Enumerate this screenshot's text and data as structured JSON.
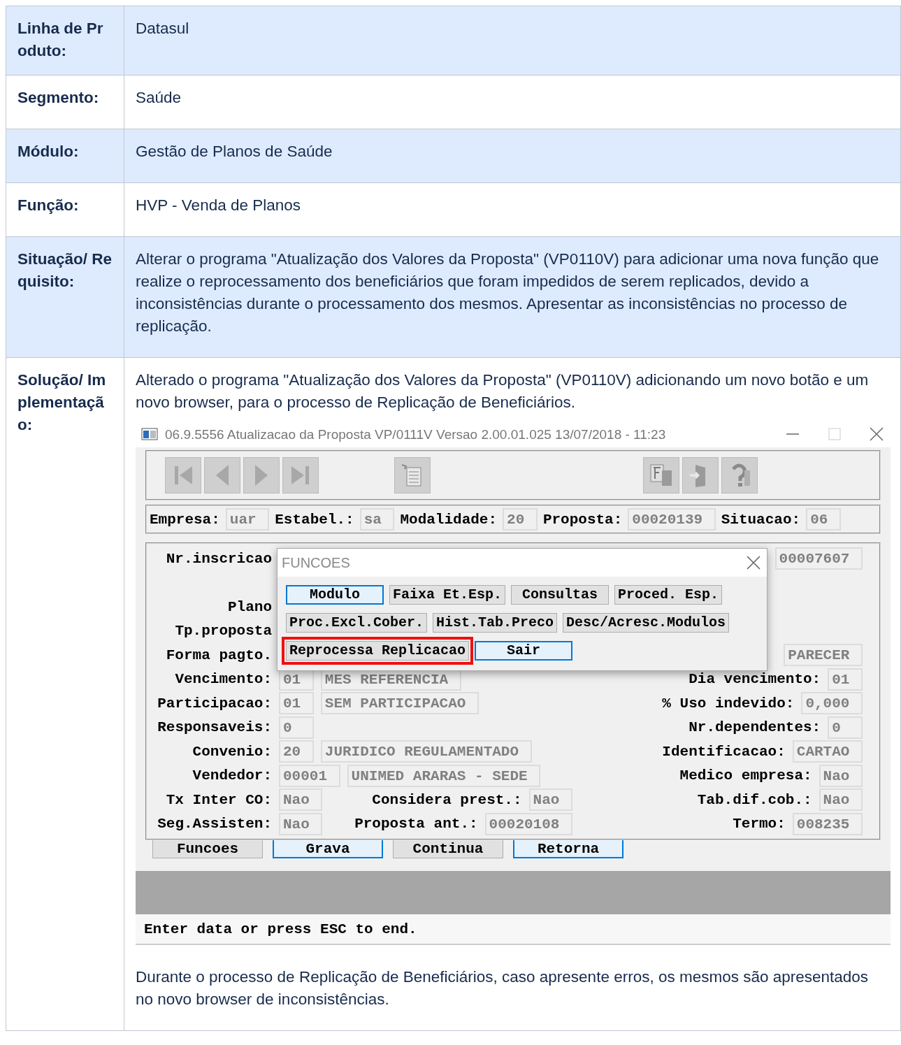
{
  "rows": [
    {
      "label": "Linha de Produto:",
      "highlighted": true,
      "content": [
        {
          "kind": "paragraph",
          "text": "Datasul"
        }
      ]
    },
    {
      "label": "Segmento:",
      "highlighted": false,
      "content": [
        {
          "kind": "paragraph",
          "text": "Saúde"
        }
      ]
    },
    {
      "label": "Módulo:",
      "highlighted": true,
      "content": [
        {
          "kind": "paragraph",
          "text": "Gestão de Planos de Saúde"
        }
      ]
    },
    {
      "label": "Função:",
      "highlighted": false,
      "content": [
        {
          "kind": "paragraph",
          "text": "HVP - Venda de Planos"
        }
      ]
    },
    {
      "label": "Situação/ Requisito:",
      "highlighted": true,
      "content": [
        {
          "kind": "paragraph",
          "text": "Alterar o programa \"Atualização dos Valores da Proposta\" (VP0110V) para adicionar uma nova função que realize o reprocessamento dos beneficiários que foram impedidos de serem replicados, devido a inconsistências durante o processamento dos mesmos. Apresentar as inconsistências no processo de replicação."
        }
      ]
    },
    {
      "label": "Solução/ Implementação:",
      "highlighted": false,
      "content": [
        {
          "kind": "paragraph",
          "text": "Alterado o programa \"Atualização dos Valores da Proposta\" (VP0110V) adicionando um novo botão e um novo browser, para o processo de Replicação de Beneficiários."
        },
        {
          "kind": "screenshot",
          "window": {
            "title": "06.9.5556 Atualizacao da Proposta VP/0111V Versao 2.00.01.025 13/07/2018 - 11:23",
            "header_fields": [
              {
                "label": "Empresa:",
                "value": "uar"
              },
              {
                "label": "Estabel.:",
                "value": "sa"
              },
              {
                "label": "Modalidade:",
                "value": "20"
              },
              {
                "label": "Proposta:",
                "value": "00020139"
              },
              {
                "label": "Situacao:",
                "value": "06"
              }
            ],
            "form_rows": [
              {
                "kind": "fields",
                "groups": [
                  {
                    "label": "Nr.inscricao"
                  },
                  {
                    "fields": [
                      "00007607"
                    ]
                  }
                ]
              },
              {
                "kind": "blank"
              },
              {
                "kind": "fields",
                "groups": [
                  {
                    "label": "Plano"
                  }
                ]
              },
              {
                "kind": "fields",
                "groups": [
                  {
                    "label": "Tp.proposta"
                  }
                ]
              },
              {
                "kind": "fields",
                "groups": [
                  {
                    "label": "Forma pagto."
                  },
                  {
                    "fields": [
                      "PARECER"
                    ]
                  }
                ]
              },
              {
                "kind": "fields",
                "groups": [
                  {
                    "label": "Vencimento:",
                    "fields": [
                      "01",
                      "MES REFERENCIA"
                    ]
                  },
                  {
                    "label": "Dia vencimento:",
                    "fields": [
                      "01"
                    ]
                  }
                ]
              },
              {
                "kind": "fields",
                "groups": [
                  {
                    "label": "Participacao:",
                    "fields": [
                      "01",
                      "SEM PARTICIPACAO"
                    ]
                  },
                  {
                    "label": "% Uso indevido:",
                    "fields": [
                      "0,000"
                    ]
                  }
                ]
              },
              {
                "kind": "fields",
                "groups": [
                  {
                    "label": "Responsaveis:",
                    "fields": [
                      "0"
                    ]
                  },
                  {
                    "label": "Nr.dependentes:",
                    "fields": [
                      "0"
                    ]
                  }
                ]
              },
              {
                "kind": "fields",
                "groups": [
                  {
                    "label": "Convenio:",
                    "fields": [
                      "20",
                      "JURIDICO REGULAMENTADO"
                    ]
                  },
                  {
                    "label": "Identificacao:",
                    "fields": [
                      "CARTAO"
                    ]
                  }
                ]
              },
              {
                "kind": "fields",
                "groups": [
                  {
                    "label": "Vendedor:",
                    "fields": [
                      "00001",
                      "UNIMED ARARAS - SEDE"
                    ]
                  },
                  {
                    "label": "Medico empresa:",
                    "fields": [
                      "Nao"
                    ]
                  }
                ]
              },
              {
                "kind": "fields",
                "groups": [
                  {
                    "label": "Tx Inter CO:",
                    "fields": [
                      "Nao"
                    ]
                  },
                  {
                    "label": "Considera prest.:",
                    "fields": [
                      "Nao"
                    ]
                  },
                  {
                    "label": "Tab.dif.cob.:",
                    "fields": [
                      "Nao"
                    ]
                  }
                ]
              },
              {
                "kind": "fields",
                "groups": [
                  {
                    "label": "Seg.Assisten:",
                    "fields": [
                      "Nao"
                    ]
                  },
                  {
                    "label": "Proposta ant.:",
                    "fields": [
                      "00020108"
                    ]
                  },
                  {
                    "label": "Termo:",
                    "fields": [
                      "008235"
                    ]
                  }
                ]
              }
            ],
            "buttons": [
              {
                "label": "Funcoes",
                "highlighted": false
              },
              {
                "label": "Grava",
                "highlighted": true
              },
              {
                "label": "Continua",
                "highlighted": false
              },
              {
                "label": "Retorna",
                "highlighted": true
              }
            ],
            "dialog": {
              "title": "FUNCOES",
              "button_rows": [
                [
                  {
                    "label": "Modulo",
                    "highlighted": true,
                    "marked": false
                  },
                  {
                    "label": "Faixa Et.Esp.",
                    "highlighted": false,
                    "marked": false
                  },
                  {
                    "label": "Consultas",
                    "highlighted": false,
                    "marked": false
                  },
                  {
                    "label": "Proced. Esp.",
                    "highlighted": false,
                    "marked": false
                  }
                ],
                [
                  {
                    "label": "Proc.Excl.Cober.",
                    "highlighted": false,
                    "marked": false
                  },
                  {
                    "label": "Hist.Tab.Preco",
                    "highlighted": false,
                    "marked": false
                  },
                  {
                    "label": "Desc/Acresc.Modulos",
                    "highlighted": false,
                    "marked": false
                  }
                ],
                [
                  {
                    "label": "Reprocessa Replicacao",
                    "highlighted": false,
                    "marked": true
                  },
                  {
                    "label": "Sair",
                    "highlighted": true,
                    "marked": false
                  }
                ]
              ]
            },
            "status": "Enter data or press ESC to end."
          }
        },
        {
          "kind": "paragraph",
          "text": "Durante o processo de Replicação de Beneficiários, caso apresente erros, os mesmos são apresentados no novo browser de inconsistências."
        }
      ]
    }
  ]
}
